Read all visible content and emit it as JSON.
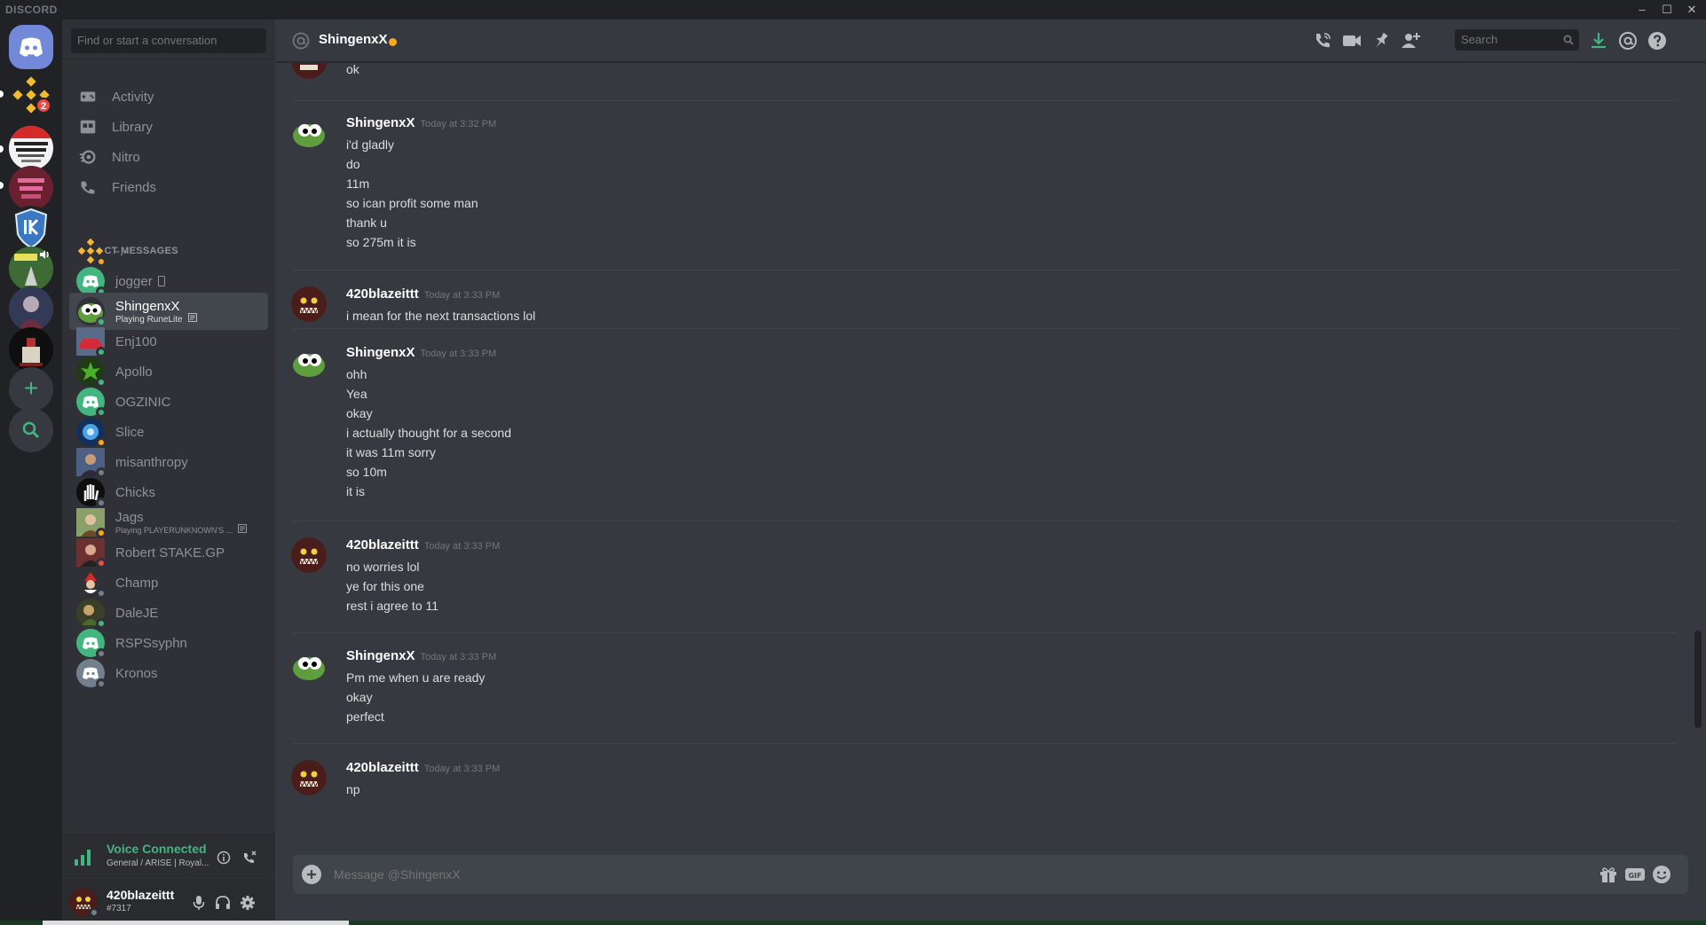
{
  "app": {
    "name": "DISCORD",
    "window_controls": [
      "–",
      "☐",
      "✕"
    ]
  },
  "guilds": {
    "home_label": "Home",
    "badge_count": "2",
    "add_server_label": "+",
    "explore_label": "Explore"
  },
  "sidebar": {
    "search_placeholder": "Find or start a conversation",
    "nav": [
      {
        "label": "Activity"
      },
      {
        "label": "Library"
      },
      {
        "label": "Nitro"
      },
      {
        "label": "Friends"
      }
    ],
    "dm_header": "DIRECT MESSAGES",
    "dms": [
      {
        "name": "-.-",
        "sub": ""
      },
      {
        "name": "jogger",
        "sub": ""
      },
      {
        "name": "ShingenxX",
        "sub": "Playing RuneLite"
      },
      {
        "name": "Enj100",
        "sub": ""
      },
      {
        "name": "Apollo",
        "sub": ""
      },
      {
        "name": "OGZINIC",
        "sub": ""
      },
      {
        "name": "Slice",
        "sub": ""
      },
      {
        "name": "misanthropy",
        "sub": ""
      },
      {
        "name": "Chicks",
        "sub": ""
      },
      {
        "name": "Jags",
        "sub": "Playing PLAYERUNKNOWN'S ..."
      },
      {
        "name": "Robert STAKE.GP",
        "sub": ""
      },
      {
        "name": "Champ",
        "sub": ""
      },
      {
        "name": "DaleJE",
        "sub": ""
      },
      {
        "name": "RSPSsyphn",
        "sub": ""
      },
      {
        "name": "Kronos",
        "sub": ""
      }
    ],
    "voice": {
      "title": "Voice Connected",
      "sub": "General / ARISE | Royal..."
    },
    "user": {
      "name": "420blazeittt",
      "tag": "#7317"
    }
  },
  "chat": {
    "title": "ShingenxX",
    "search_placeholder": "Search",
    "composer_placeholder": "Message @ShingenxX",
    "partial_top_line": "ok",
    "messages": [
      {
        "author": "ShingenxX",
        "time": "Today at 3:32 PM",
        "lines": [
          "i'd gladly",
          "do",
          "11m",
          "so  ican profit some man",
          "thank u",
          "so 275m it is"
        ]
      },
      {
        "author": "420blazeittt",
        "time": "Today at 3:33 PM",
        "lines": [
          "i mean for the next transactions lol"
        ]
      },
      {
        "author": "ShingenxX",
        "time": "Today at 3:33 PM",
        "lines": [
          "ohh",
          "Yea",
          "okay",
          "i actually thought for a second",
          "it was 11m sorry",
          "so 10m",
          "it is"
        ]
      },
      {
        "author": "420blazeittt",
        "time": "Today at 3:33 PM",
        "lines": [
          "no worries lol",
          "ye for this one",
          "rest i agree to 11"
        ]
      },
      {
        "author": "ShingenxX",
        "time": "Today at 3:33 PM",
        "lines": [
          "Pm me when u are ready",
          "okay",
          "perfect"
        ]
      },
      {
        "author": "420blazeittt",
        "time": "Today at 3:33 PM",
        "lines": [
          "np"
        ]
      }
    ]
  },
  "colors": {
    "online": "#43b581",
    "idle": "#faa61a",
    "dnd": "#f04747",
    "offline": "#747f8d",
    "blurple": "#7289da"
  }
}
